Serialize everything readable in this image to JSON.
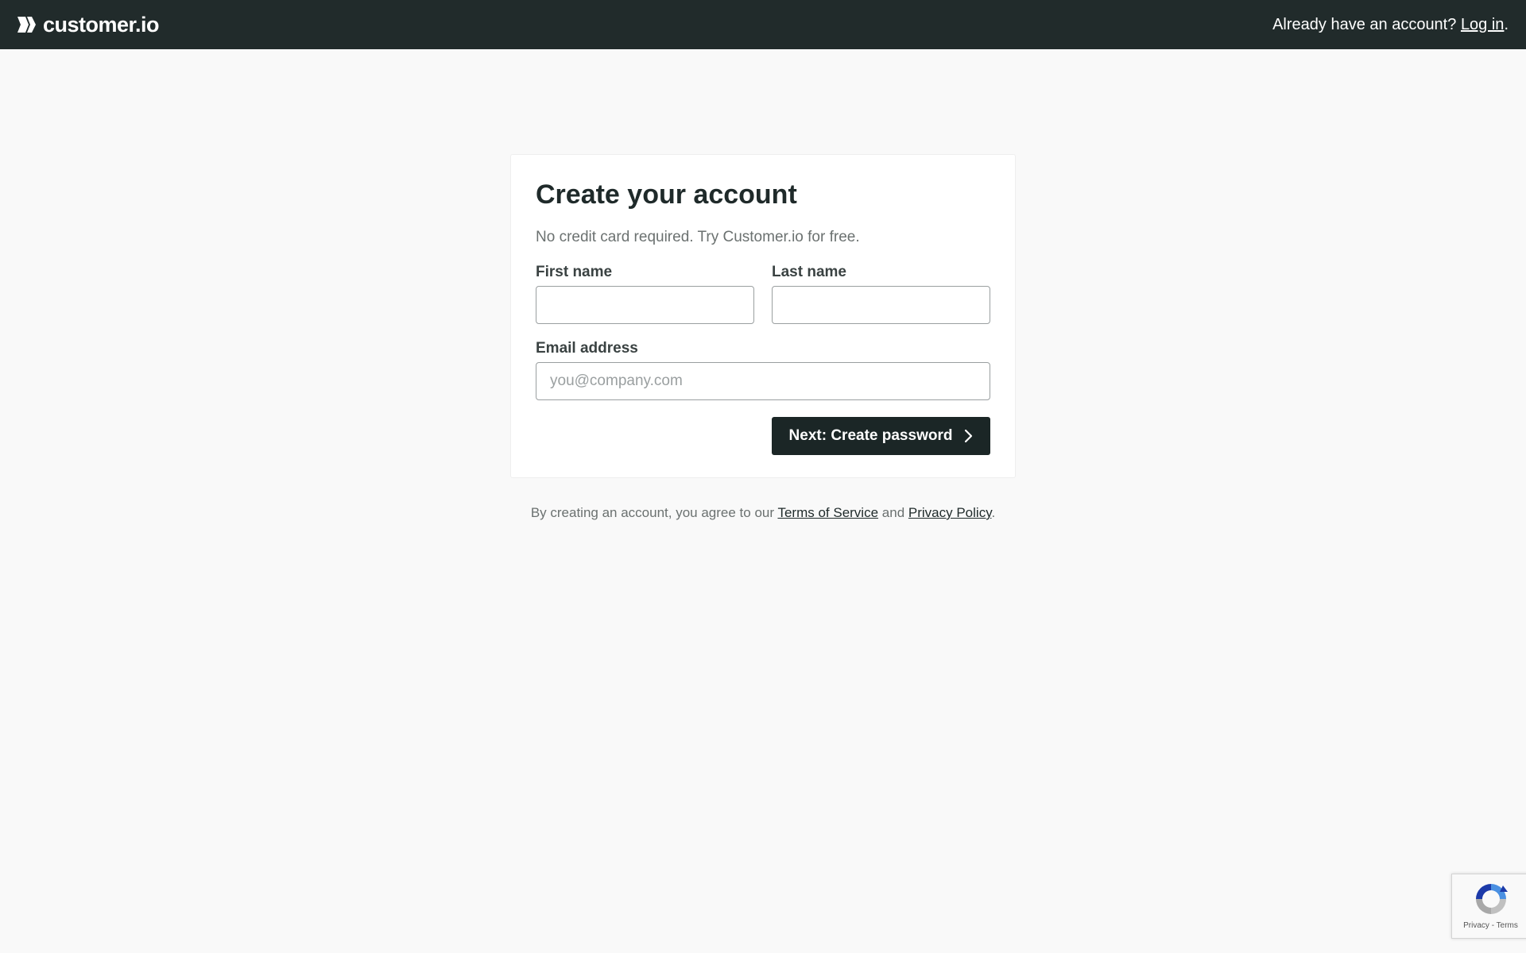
{
  "header": {
    "brand": "customer.io",
    "login_prompt": "Already have an account?",
    "login_link": "Log in",
    "login_suffix": "."
  },
  "form": {
    "title": "Create your account",
    "subtitle": "No credit card required. Try Customer.io for free.",
    "first_name_label": "First name",
    "first_name_value": "",
    "last_name_label": "Last name",
    "last_name_value": "",
    "email_label": "Email address",
    "email_placeholder": "you@company.com",
    "email_value": "",
    "next_button": "Next: Create password"
  },
  "legal": {
    "prefix": "By creating an account, you agree to our",
    "terms": "Terms of Service",
    "and": "and",
    "privacy": "Privacy Policy",
    "suffix": "."
  },
  "recaptcha": {
    "privacy": "Privacy",
    "separator": " - ",
    "terms": "Terms"
  },
  "colors": {
    "header_bg": "#212b2b",
    "button_bg": "#1b2626",
    "page_bg": "#f9f9f9"
  },
  "icons": {
    "logo": "customerio-logo-icon",
    "button": "chevron-right-icon",
    "recaptcha": "recaptcha-icon"
  }
}
